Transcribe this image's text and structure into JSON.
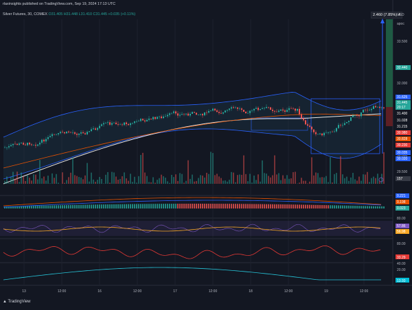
{
  "header": {
    "published": "rlaxinsights published on TradingView.com, Sep 19, 2024 17:13 UTC",
    "symbol": "Silver Futures, 30, COMEX",
    "ohlc": "O31.405 H31.448 L31.410 C31.445 +0.035 (+0.11%)"
  },
  "top_badge": "2.460 (7.85%) 4",
  "currency": "USD",
  "apoc": "apoc",
  "price_axis": [
    "33.500",
    "32.000",
    "31.500",
    "30.500",
    "30.000",
    "29.500"
  ],
  "price_tags": [
    {
      "text": "32.440",
      "color": "#26a69a"
    },
    {
      "text": "31.625",
      "color": "#2962ff"
    },
    {
      "text": "31.445",
      "color": "#26a69a"
    },
    {
      "text": "20:17",
      "color": "#26a69a"
    },
    {
      "text": "31.400",
      "color": "#131722"
    },
    {
      "text": "31.028",
      "color": "#131722"
    },
    {
      "text": "31.215",
      "color": "#131722"
    },
    {
      "text": "30.980",
      "color": "#e53935"
    },
    {
      "text": "30.828",
      "color": "#e65100"
    },
    {
      "text": "30.230",
      "color": "#e53935"
    },
    {
      "text": "30.035",
      "color": "#2962ff"
    },
    {
      "text": "30.020",
      "color": "#2962ff"
    },
    {
      "text": "157",
      "color": "#363a45"
    }
  ],
  "osc_tags": [
    {
      "text": "0.221",
      "color": "#2962ff"
    },
    {
      "text": "0.198",
      "color": "#e65100"
    },
    {
      "text": "0.023",
      "color": "#26a69a"
    }
  ],
  "rsi_axis": [
    "80.00",
    "20.00"
  ],
  "rsi_tags": [
    {
      "text": "57.86",
      "color": "#7e57c2"
    },
    {
      "text": "56.98",
      "color": "#f9a825"
    }
  ],
  "pane4_axis": [
    "80.00",
    "40.00"
  ],
  "pane4_tag": {
    "text": "33.29",
    "color": "#e53935"
  },
  "pane5_axis": [
    "20.00"
  ],
  "pane5_tag": {
    "text": "13.93",
    "color": "#00bcd4"
  },
  "x_labels": [
    "13",
    "12:00",
    "16",
    "12:00",
    "17",
    "12:00",
    "18",
    "12:00",
    "19",
    "12:00"
  ],
  "logo_text": "TradingView"
}
